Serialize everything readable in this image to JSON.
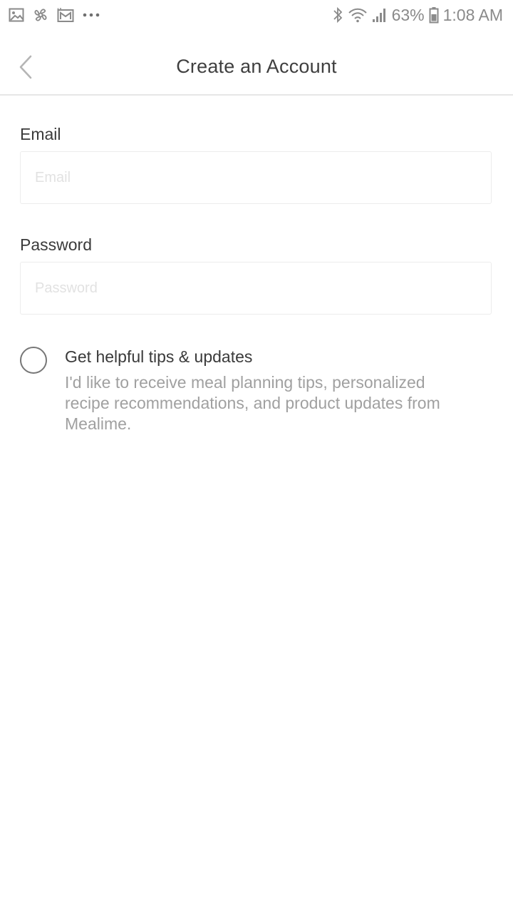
{
  "status_bar": {
    "left_icons": [
      "gallery-icon",
      "pinwheel-icon",
      "email-icon",
      "more-dots-icon"
    ],
    "right_icons": [
      "bluetooth-icon",
      "wifi-icon",
      "signal-icon",
      "battery-icon"
    ],
    "battery_percent": "63%",
    "time": "1:08 AM"
  },
  "header": {
    "title": "Create an Account"
  },
  "form": {
    "email": {
      "label": "Email",
      "placeholder": "Email",
      "value": ""
    },
    "password": {
      "label": "Password",
      "placeholder": "Password",
      "value": ""
    }
  },
  "optin": {
    "checked": false,
    "title": "Get helpful tips & updates",
    "description": "I'd like to receive meal planning tips, personalized recipe recommendations, and product updates from Mealime."
  },
  "colors": {
    "text_primary": "#3a3a3a",
    "text_secondary": "#a0a0a0",
    "placeholder": "#e2e2e2",
    "divider": "#e6e6e6"
  }
}
